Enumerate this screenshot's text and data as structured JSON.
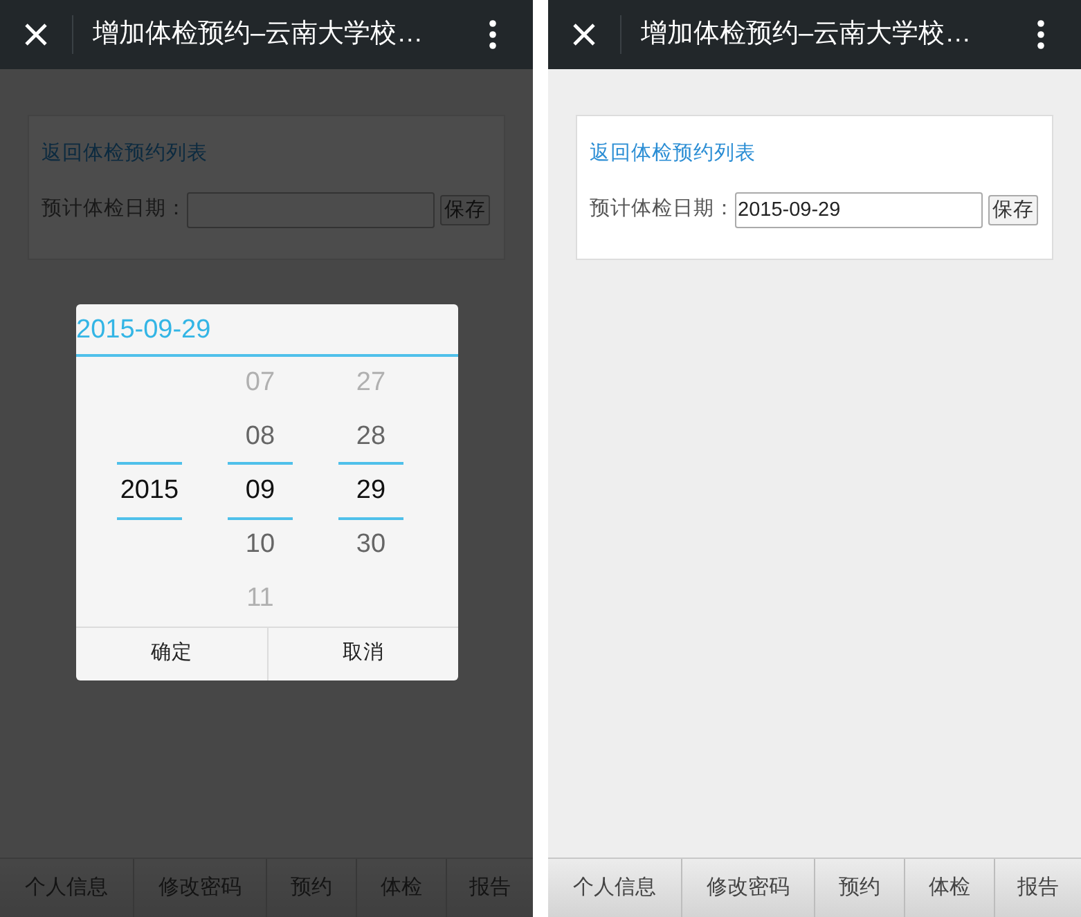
{
  "screens": [
    {
      "title": "增加体检预约–云南大学校…",
      "back_link": "返回体检预约列表",
      "date_label": "预计体检日期：",
      "save": "保存",
      "dimmed": true,
      "picker": {
        "header": "2015-09-29",
        "columns": [
          {
            "items": [
              {
                "text": "2015",
                "selected": true
              }
            ]
          },
          {
            "items": [
              {
                "text": "07",
                "selected": false
              },
              {
                "text": "08",
                "selected": false
              },
              {
                "text": "09",
                "selected": true
              },
              {
                "text": "10",
                "selected": false
              },
              {
                "text": "11",
                "selected": false
              }
            ]
          },
          {
            "items": [
              {
                "text": "27",
                "selected": false
              },
              {
                "text": "28",
                "selected": false
              },
              {
                "text": "29",
                "selected": true
              },
              {
                "text": "30",
                "selected": false
              }
            ]
          }
        ],
        "buttons": [
          "确定",
          "取消"
        ]
      },
      "tabs": [
        "个人信息",
        "修改密码",
        "预约",
        "体检",
        "报告"
      ]
    },
    {
      "title": "增加体检预约–云南大学校…",
      "back_link": "返回体检预约列表",
      "date_label": "预计体检日期：",
      "date_value": "2015-09-29",
      "save": "保存",
      "dimmed": false,
      "tabs": [
        "个人信息",
        "修改密码",
        "预约",
        "体检",
        "报告"
      ]
    }
  ]
}
